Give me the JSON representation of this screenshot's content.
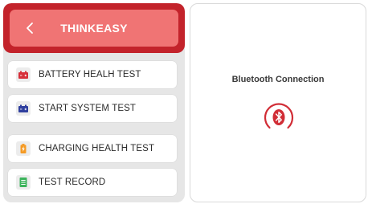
{
  "header": {
    "title": "THINKEASY"
  },
  "menu": {
    "items": [
      {
        "label": "BATTERY HEALH TEST",
        "icon": "battery-icon",
        "icon_color": "#d6303a"
      },
      {
        "label": "START SYSTEM TEST",
        "icon": "battery-icon",
        "icon_color": "#2f3f9e"
      },
      {
        "label": "CHARGING HEALTH TEST",
        "icon": "charging-battery-icon",
        "icon_color": "#f59a23"
      },
      {
        "label": "TEST RECORD",
        "icon": "document-icon",
        "icon_color": "#3cb35b"
      }
    ]
  },
  "bluetooth": {
    "title": "Bluetooth Connection",
    "icon": "bluetooth-icon"
  },
  "colors": {
    "accent": "#c3232b",
    "accent_light": "#f07474",
    "panel_bg": "#e6e6e6"
  }
}
